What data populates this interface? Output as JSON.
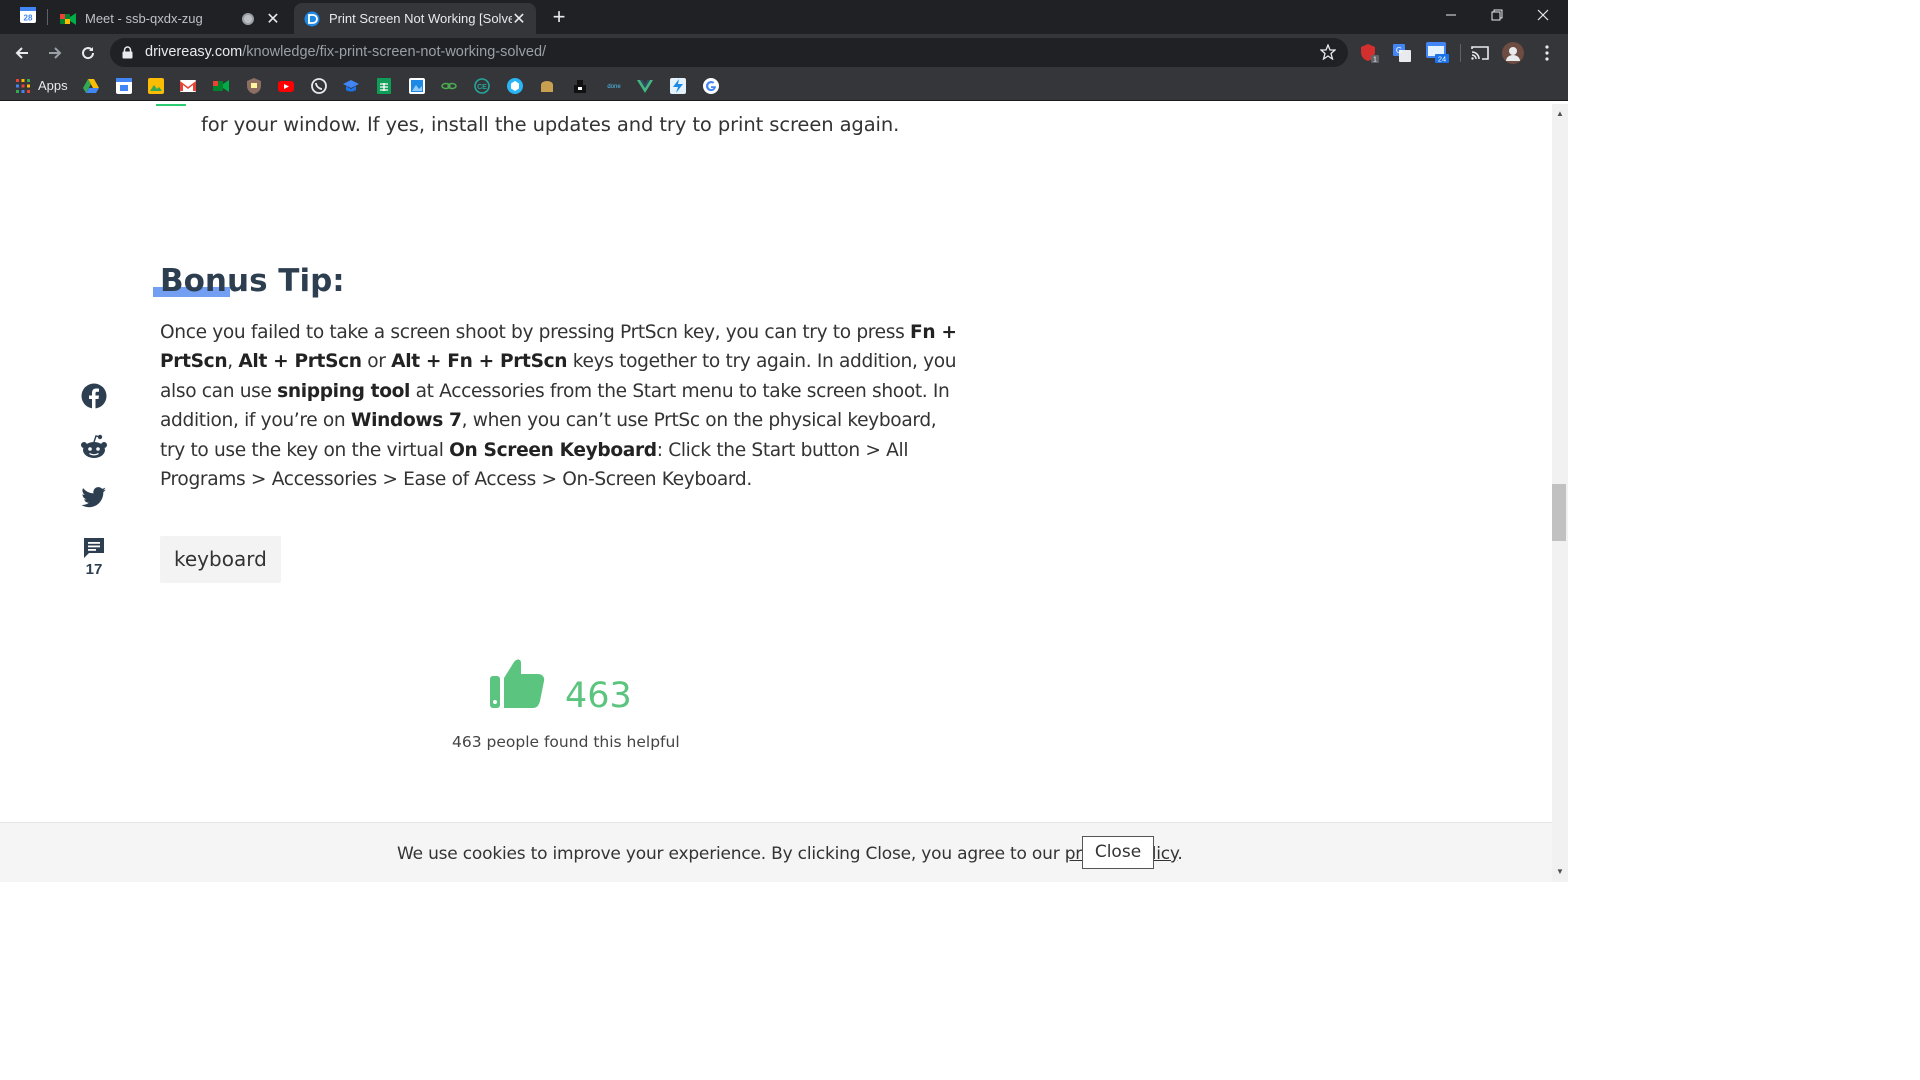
{
  "browser": {
    "pinned_tab_icon": "google-calendar-icon",
    "pinned_tab_badge": "28",
    "tabs": [
      {
        "title": "Meet - ssb-qxdx-zug",
        "icon": "google-meet-icon",
        "active": false
      },
      {
        "title": "Print Screen Not Working [Solved]",
        "icon": "drivereasy-icon",
        "active": true
      }
    ],
    "url_host": "drivereasy.com",
    "url_path": "/knowledge/fix-print-screen-not-working-solved/",
    "extension_badges": {
      "first": "1",
      "calendar": "24"
    },
    "bookmarks_apps_label": "Apps",
    "bookmark_icons": [
      "google-drive-icon",
      "google-calendar-icon",
      "google-photos-icon",
      "gmail-icon",
      "google-meet-icon",
      "shield-icon",
      "youtube-icon",
      "whatsapp-icon",
      "graduation-cap-icon",
      "google-sheets-icon",
      "image-editor-icon",
      "link-icon",
      "globe-icon",
      "cube-icon",
      "bread-icon",
      "crown-icon",
      "text-logo-icon",
      "vuejs-icon",
      "lightning-icon",
      "google-icon"
    ]
  },
  "article": {
    "previous_text": "for your window. If yes, install the updates and try to print screen again.",
    "bonus_title": "Bonus Tip:",
    "bonus_body": [
      {
        "t": "Once you failed to take a screen shoot by pressing PrtScn key, you can try to press ",
        "b": false
      },
      {
        "t": "Fn + PrtScn",
        "b": true
      },
      {
        "t": ", ",
        "b": false
      },
      {
        "t": "Alt + PrtScn",
        "b": true
      },
      {
        "t": " or ",
        "b": false
      },
      {
        "t": "Alt + Fn + PrtScn",
        "b": true
      },
      {
        "t": " keys together to try again. In addition, you also can use ",
        "b": false
      },
      {
        "t": "snipping tool",
        "b": true
      },
      {
        "t": " at Accessories from the Start menu to take screen shoot. In addition, if you’re on ",
        "b": false
      },
      {
        "t": "Windows 7",
        "b": true
      },
      {
        "t": ", when you can’t use PrtSc on the physical keyboard, try to use the key on the virtual ",
        "b": false
      },
      {
        "t": "On Screen Keyboard",
        "b": true
      },
      {
        "t": ": Click the Start button > All Programs > Accessories > Ease of Access > On-Screen Keyboard.",
        "b": false
      }
    ],
    "tag": "keyboard",
    "likes": "463",
    "helpful_text": "463 people found this helpful"
  },
  "social": {
    "comment_count": "17"
  },
  "cookie": {
    "text_before": "We use cookies to improve your experience. By clicking Close, you agree to our ",
    "link": "privacy policy",
    "text_after": ".",
    "close_label": "Close"
  },
  "colors": {
    "accent_green": "#5bc47e",
    "heading": "#2c3e50",
    "highlight_blue": "#5b8ef0"
  }
}
